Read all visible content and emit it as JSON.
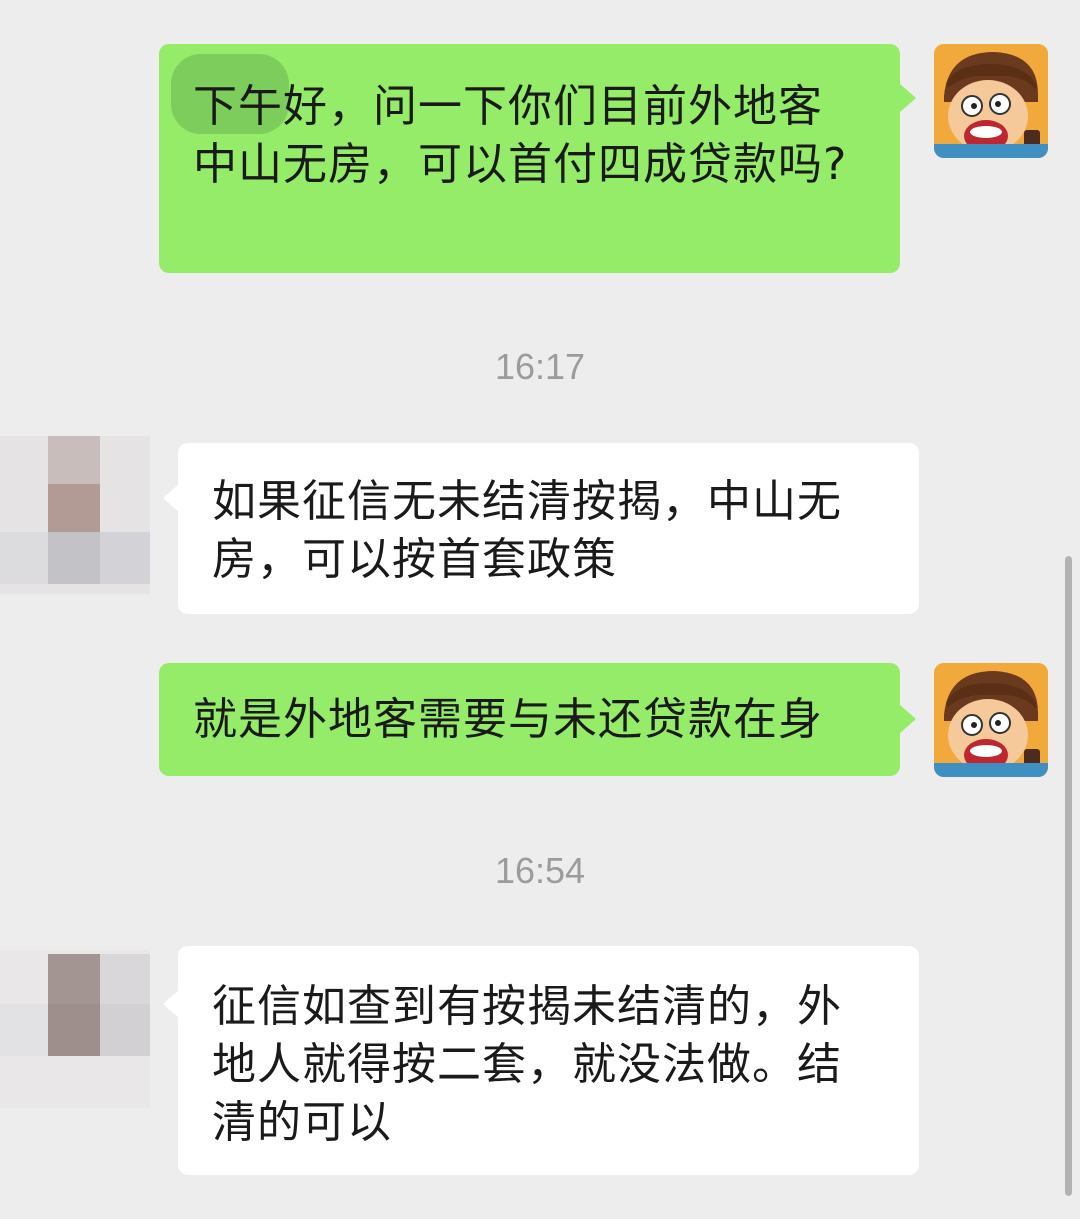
{
  "messages": {
    "m1": {
      "sender": "self",
      "text": "下午好，问一下你们目前外地客中山无房，可以首付四成贷款吗?"
    },
    "t1": "16:17",
    "m2": {
      "sender": "other",
      "text": "如果征信无未结清按揭，中山无房，可以按首套政策"
    },
    "m3": {
      "sender": "self",
      "text": "就是外地客需要与未还贷款在身"
    },
    "t2": "16:54",
    "m4": {
      "sender": "other",
      "text": "征信如查到有按揭未结清的，外地人就得按二套，就没法做。结清的可以"
    }
  },
  "colors": {
    "background": "#ededed",
    "outgoing_bubble": "#95ec69",
    "incoming_bubble": "#ffffff",
    "timestamp_text": "#9b9b9b"
  },
  "icons": {
    "self_avatar": "cartoon-boy-avatar",
    "other_avatar": "pixelated-avatar"
  }
}
